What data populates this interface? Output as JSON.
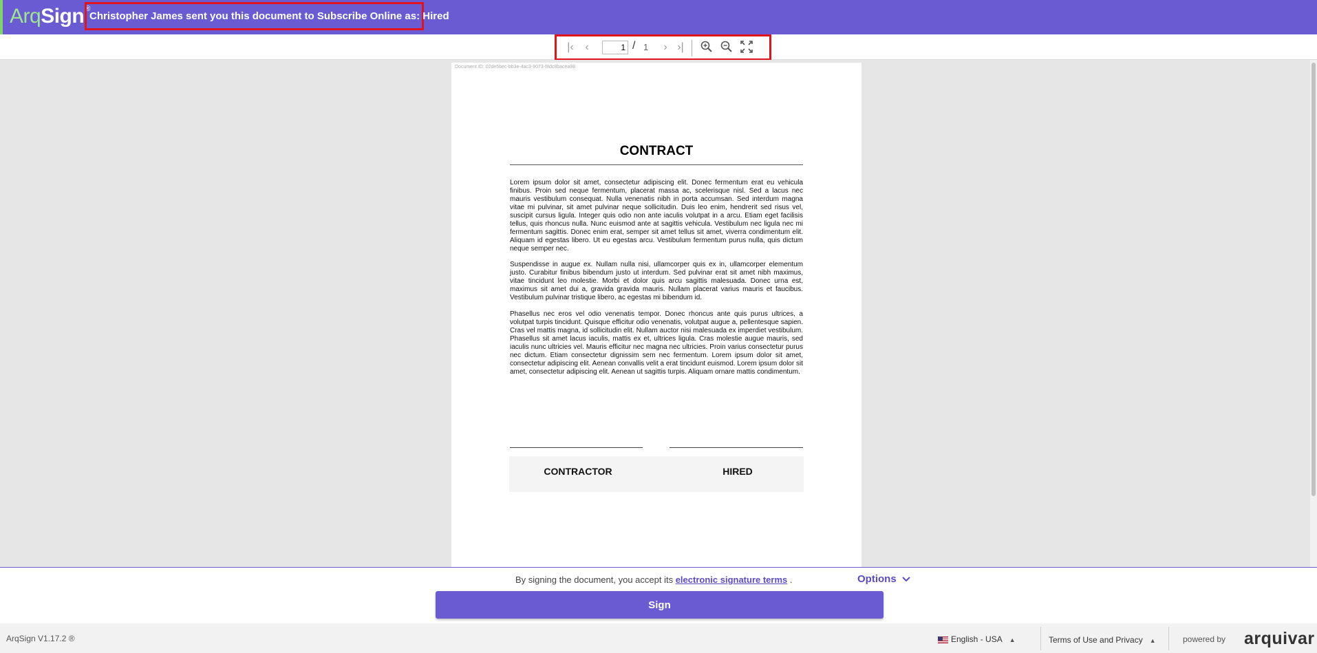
{
  "header": {
    "logo_arq": "Arq",
    "logo_sign": "Sign",
    "logo_reg": "®",
    "title": "Christopher James sent you this document to Subscribe Online as: Hired"
  },
  "toolbar": {
    "page_value": "1",
    "separator": "/",
    "total_pages": "1",
    "icons": [
      "first-page-icon",
      "prev-page-icon",
      "next-page-icon",
      "last-page-icon",
      "zoom-in-icon",
      "zoom-out-icon",
      "fullscreen-icon"
    ]
  },
  "document": {
    "id_text": "Document ID: 02de5bec-bb3e-4ac3-9073-f8dc8bacea98",
    "title": "CONTRACT",
    "paragraphs": [
      "Lorem ipsum dolor sit amet, consectetur adipiscing elit. Donec fermentum erat eu vehicula finibus. Proin sed neque fermentum, placerat massa ac, scelerisque nisl. Sed a lacus nec mauris vestibulum consequat. Nulla venenatis nibh in porta accumsan. Sed interdum magna vitae mi pulvinar, sit amet pulvinar neque sollicitudin. Duis leo enim, hendrerit sed risus vel, suscipit cursus ligula. Integer quis odio non ante iaculis volutpat in a arcu. Etiam eget facilisis tellus, quis rhoncus nulla. Nunc euismod ante at sagittis vehicula. Vestibulum nec ligula nec mi fermentum sagittis. Donec enim erat, semper sit amet tellus sit amet, viverra condimentum elit. Aliquam id egestas libero. Ut eu egestas arcu. Vestibulum fermentum purus nulla, quis dictum neque semper nec.",
      "Suspendisse in augue ex. Nullam nulla nisi, ullamcorper quis ex in, ullamcorper elementum justo. Curabitur finibus bibendum justo ut interdum. Sed pulvinar erat sit amet nibh maximus, vitae tincidunt leo molestie. Morbi et dolor quis arcu sagittis malesuada. Donec urna est, maximus sit amet dui a, gravida gravida mauris. Nullam placerat varius mauris et faucibus. Vestibulum pulvinar tristique libero, ac egestas mi bibendum id.",
      "Phasellus nec eros vel odio venenatis tempor. Donec rhoncus ante quis purus ultrices, a volutpat turpis tincidunt. Quisque efficitur odio venenatis, volutpat augue a, pellentesque sapien. Cras vel mattis magna, id sollicitudin elit. Nullam auctor nisi malesuada ex imperdiet vestibulum. Phasellus sit amet lacus iaculis, mattis ex et, ultrices ligula. Cras molestie augue mauris, sed iaculis nunc ultricies vel. Mauris efficitur nec magna nec ultricies. Proin varius consectetur purus nec dictum. Etiam consectetur dignissim sem nec fermentum. Lorem ipsum dolor sit amet, consectetur adipiscing elit. Aenean convallis velit a erat tincidunt euismod. Lorem ipsum dolor sit amet, consectetur adipiscing elit. Aenean ut sagittis turpis. Aliquam ornare mattis condimentum."
    ],
    "signatories": [
      "CONTRACTOR",
      "HIRED"
    ]
  },
  "action": {
    "terms_prefix": "By signing the document, you accept its",
    "terms_link": "electronic signature terms",
    "terms_suffix": ".",
    "options_label": "Options",
    "sign_label": "Sign"
  },
  "footer": {
    "version": "ArqSign V1.17.2 ®",
    "language": "English - USA",
    "terms": "Terms of Use and Privacy",
    "powered_by": "powered by",
    "brand": "arquivar"
  },
  "colors": {
    "brand_purple": "#6b5bd2",
    "logo_green": "#9ee58f",
    "highlight_red": "#e1141e"
  }
}
